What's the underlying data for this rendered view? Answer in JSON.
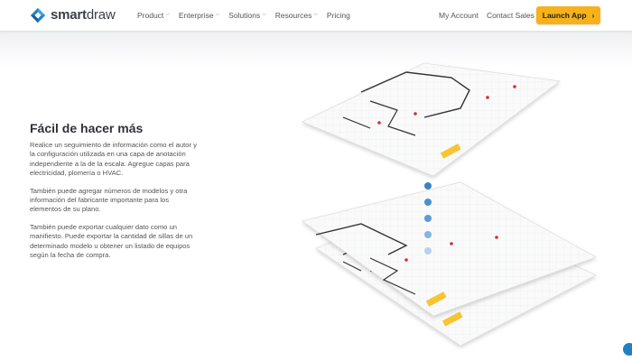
{
  "brand": {
    "name_bold": "smart",
    "name_light": "draw",
    "colors": {
      "primary": "#1f7fc7",
      "accent": "#f7b21b"
    }
  },
  "nav": {
    "items": [
      {
        "label": "Product",
        "icon": "chevron-down-icon"
      },
      {
        "label": "Enterprise",
        "icon": "chevron-down-icon"
      },
      {
        "label": "Solutions",
        "icon": "chevron-down-icon"
      },
      {
        "label": "Resources",
        "icon": "chevron-down-icon"
      },
      {
        "label": "Pricing"
      }
    ],
    "my_account": "My Account",
    "contact_sales": "Contact Sales",
    "launch_app": "Launch App",
    "launch_icon": "chevron-right-icon"
  },
  "content": {
    "heading": "Fácil de hacer más",
    "paragraphs": [
      "Realice un seguimiento de información como el autor y la configuración utilizada en una capa de anotación independiente a la de la escala. Agregue capas para electricidad, plomería o HVAC.",
      "También puede agregar números de modelos y otra información del fabricante importante para los elementos de su plano.",
      "También puede exportar cualquier dato como un manifiesto. Puede exportar la cantidad de sillas de un determinado modelo u obtener un listado de equipos según la fecha de compra."
    ]
  },
  "illustration": {
    "icon": "layered-floor-plans-illustration",
    "layer_count": 3,
    "dots_icon": "layer-connector-dots"
  }
}
